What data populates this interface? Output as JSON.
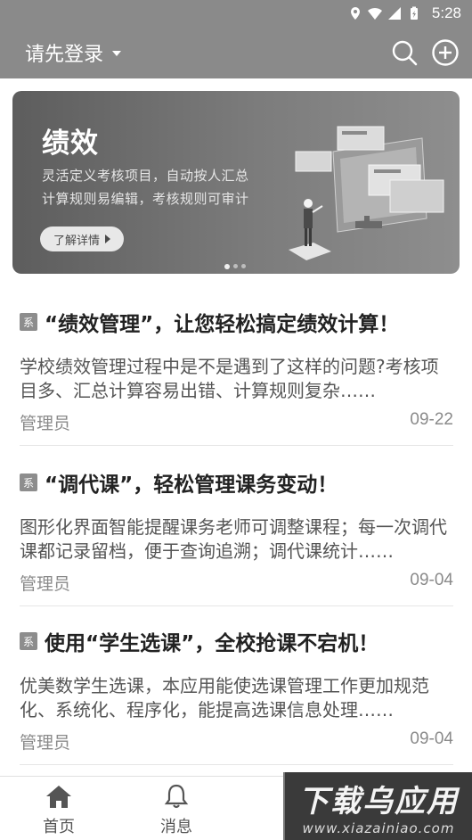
{
  "status_bar": {
    "time": "5:28",
    "icons": [
      "location-icon",
      "wifi-icon",
      "signal-icon",
      "battery-icon"
    ]
  },
  "app_bar": {
    "login_label": "请先登录",
    "icons": [
      "search-icon",
      "add-circle-icon"
    ]
  },
  "banner": {
    "title": "绩效",
    "line1": "灵活定义考核项目，自动按人汇总",
    "line2": "计算规则易编辑，考核规则可审计",
    "button_label": "了解详情",
    "pages": 3,
    "active_page": 1
  },
  "feed": [
    {
      "tag": "系",
      "title": "“绩效管理”，让您轻松搞定绩效计算！",
      "summary": "学校绩效管理过程中是不是遇到了这样的问题?考核项目多、汇总计算容易出错、计算规则复杂……",
      "author": "管理员",
      "date": "09-22"
    },
    {
      "tag": "系",
      "title": "“调代课”，轻松管理课务变动！",
      "summary": "图形化界面智能提醒课务老师可调整课程；每一次调代课都记录留档，便于查询追溯；调代课统计……",
      "author": "管理员",
      "date": "09-04"
    },
    {
      "tag": "系",
      "title": "使用“学生选课”，全校抢课不宕机！",
      "summary": "优美数学生选课，本应用能使选课管理工作更加规范化、系统化、程序化，能提高选课信息处理……",
      "author": "管理员",
      "date": "09-04"
    }
  ],
  "tab_bar": {
    "tabs": [
      {
        "label": "首页",
        "icon": "home-icon"
      },
      {
        "label": "消息",
        "icon": "bell-icon"
      }
    ]
  },
  "watermark": {
    "line1": "下载乌应用",
    "line2": "www.xiazainiao.com"
  }
}
